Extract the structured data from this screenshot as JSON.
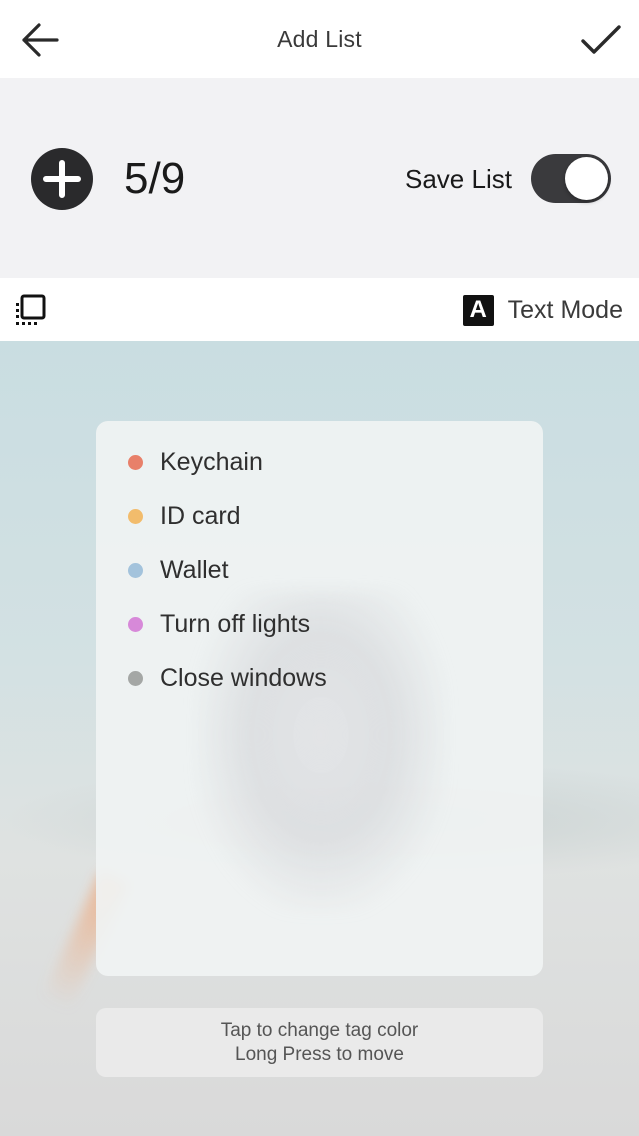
{
  "header": {
    "title": "Add List",
    "back_icon": "arrow-left-icon",
    "done_icon": "checkmark-icon"
  },
  "counter": {
    "count": "5/9",
    "save_label": "Save List",
    "save_enabled": true,
    "add_icon": "plus-circle-icon"
  },
  "mode_bar": {
    "layer_icon": "layer-select-icon",
    "text_mode_glyph": "A",
    "text_mode_label": "Text Mode"
  },
  "items": [
    {
      "label": "Keychain",
      "color": "#e8806a"
    },
    {
      "label": "ID card",
      "color": "#f2bc6c"
    },
    {
      "label": "Wallet",
      "color": "#a3c3dc"
    },
    {
      "label": "Turn off lights",
      "color": "#d789d9"
    },
    {
      "label": "Close windows",
      "color": "#a4a7a5"
    }
  ],
  "hint": {
    "line1": "Tap to change tag color",
    "line2": "Long Press to move"
  }
}
